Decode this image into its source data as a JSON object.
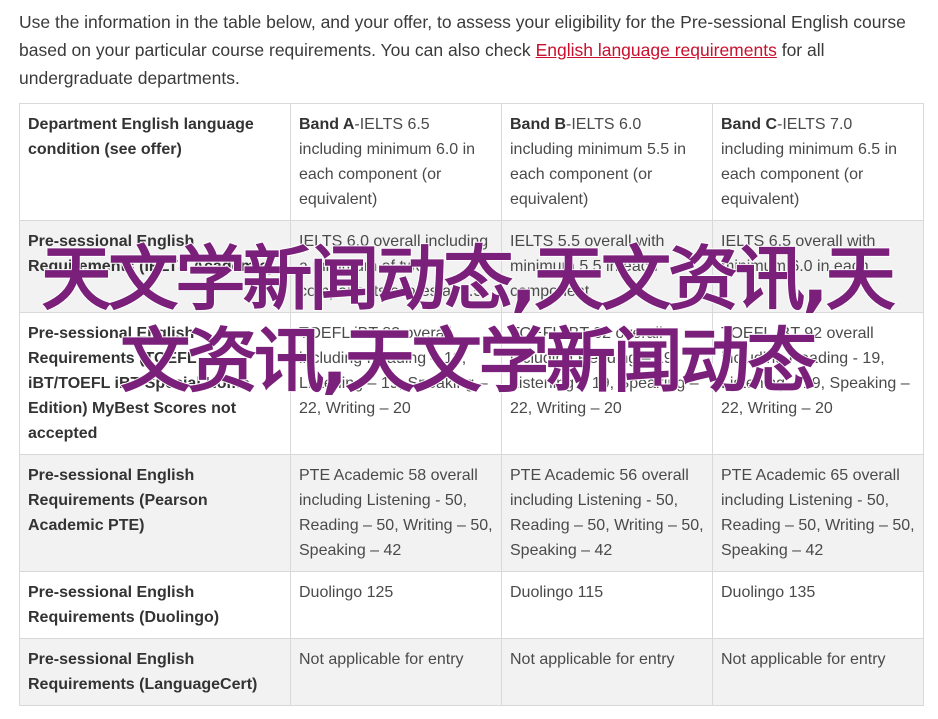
{
  "intro": {
    "text_before_link": "Use the information in the table below, and your offer, to assess your eligibility for the Pre-sessional English course based on your particular course requirements. You can also check ",
    "link_text": "English language requirements",
    "text_after_link": " for all undergraduate departments."
  },
  "table": {
    "header": {
      "condition": "Department English language condition (see offer)",
      "bands": [
        {
          "label": "Band A",
          "detail": "-IELTS 6.5 including minimum 6.0 in each component (or equivalent)"
        },
        {
          "label": "Band B",
          "detail": "-IELTS 6.0 including minimum 5.5 in each component (or equivalent)"
        },
        {
          "label": "Band C",
          "detail": "-IELTS 7.0 including minimum 6.5 in each component (or equivalent)"
        }
      ]
    },
    "rows": [
      {
        "requirement": "Pre-sessional English Requirements (IELTS Academic)",
        "values": [
          "IELTS 6.0 overall including a minimum of two components scores at 5.5",
          "IELTS 5.5 overall with minimum 5.5 in each component",
          "IELTS 6.5 overall with minimum 6.0 in each"
        ]
      },
      {
        "requirement": "Pre-sessional English Requirements (TOEFL iBT/TOEFL iBT Special Home Edition) MyBest Scores not accepted",
        "values": [
          "TOEFL iBT 82 overall including Reading – 19, Listening – 19, Speaking – 22, Writing – 20",
          "TOEFL iBT 82 overall including Reading – 19, Listening – 19, Speaking – 22, Writing – 20",
          "TOEFL iBT 92 overall including Reading - 19, Listening – 19, Speaking – 22, Writing – 20"
        ]
      },
      {
        "requirement": "Pre-sessional English Requirements (Pearson Academic PTE)",
        "values": [
          "PTE Academic 58 overall including Listening - 50, Reading – 50, Writing – 50, Speaking – 42",
          "PTE Academic 56 overall including Listening - 50, Reading – 50, Writing – 50, Speaking – 42",
          "PTE Academic 65 overall including Listening - 50, Reading – 50, Writing – 50, Speaking – 42"
        ]
      },
      {
        "requirement": "Pre-sessional English Requirements (Duolingo)",
        "values": [
          "Duolingo 125",
          "Duolingo 115",
          "Duolingo 135"
        ]
      },
      {
        "requirement": "Pre-sessional English Requirements (LanguageCert)",
        "values": [
          "Not applicable for entry",
          "Not applicable for entry",
          "Not applicable for entry"
        ]
      }
    ]
  },
  "watermark": {
    "text": "天文学新闻动态,天文资讯,天文资讯,天文学新闻动态",
    "color": "#7a1f7a"
  },
  "colors": {
    "link": "#c8102e",
    "border": "#d9d9d9",
    "zebra": "#f2f2f2"
  }
}
